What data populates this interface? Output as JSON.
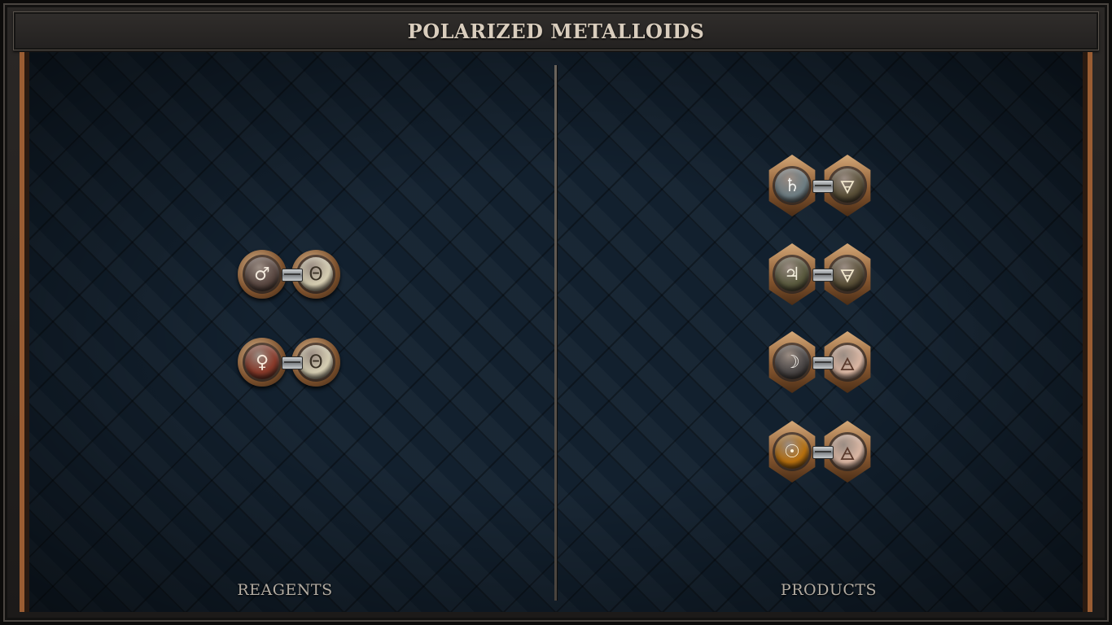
{
  "title": "POLARIZED METALLOIDS",
  "labels": {
    "reagents": "REAGENTS",
    "products": "PRODUCTS"
  },
  "reagents": [
    {
      "left": {
        "symbol": "♂",
        "element": "iron",
        "color": "#5a4842",
        "glyph": "#f2e9dc"
      },
      "right": {
        "symbol": "Θ",
        "element": "salt",
        "color": "#d8d0b4",
        "glyph": "#3a3226"
      }
    },
    {
      "left": {
        "symbol": "♀",
        "element": "copper",
        "color": "#8a3a2a",
        "glyph": "#f7e7d8"
      },
      "right": {
        "symbol": "Θ",
        "element": "salt",
        "color": "#d8d0b4",
        "glyph": "#3a3226"
      }
    }
  ],
  "products": [
    {
      "left": {
        "symbol": "♄",
        "element": "lead",
        "color": "#6e7e84",
        "glyph": "#f2f2ee"
      },
      "right": {
        "symbol": "🜃",
        "element": "earth",
        "color": "#5a5038",
        "glyph": "#f0e6cc"
      }
    },
    {
      "left": {
        "symbol": "♃",
        "element": "tin",
        "color": "#5a5a3e",
        "glyph": "#f2eedc"
      },
      "right": {
        "symbol": "🜃",
        "element": "earth",
        "color": "#5a5038",
        "glyph": "#f0e6cc"
      }
    },
    {
      "left": {
        "symbol": "☽",
        "element": "silver",
        "color": "#4a4646",
        "glyph": "#f4f0ea"
      },
      "right": {
        "symbol": "🜁",
        "element": "air",
        "color": "#dcb8a4",
        "glyph": "#5a3a2c"
      }
    },
    {
      "left": {
        "symbol": "☉",
        "element": "gold",
        "color": "#b8700e",
        "glyph": "#fff4dc"
      },
      "right": {
        "symbol": "🜁",
        "element": "air",
        "color": "#dcb8a4",
        "glyph": "#5a3a2c"
      }
    }
  ]
}
